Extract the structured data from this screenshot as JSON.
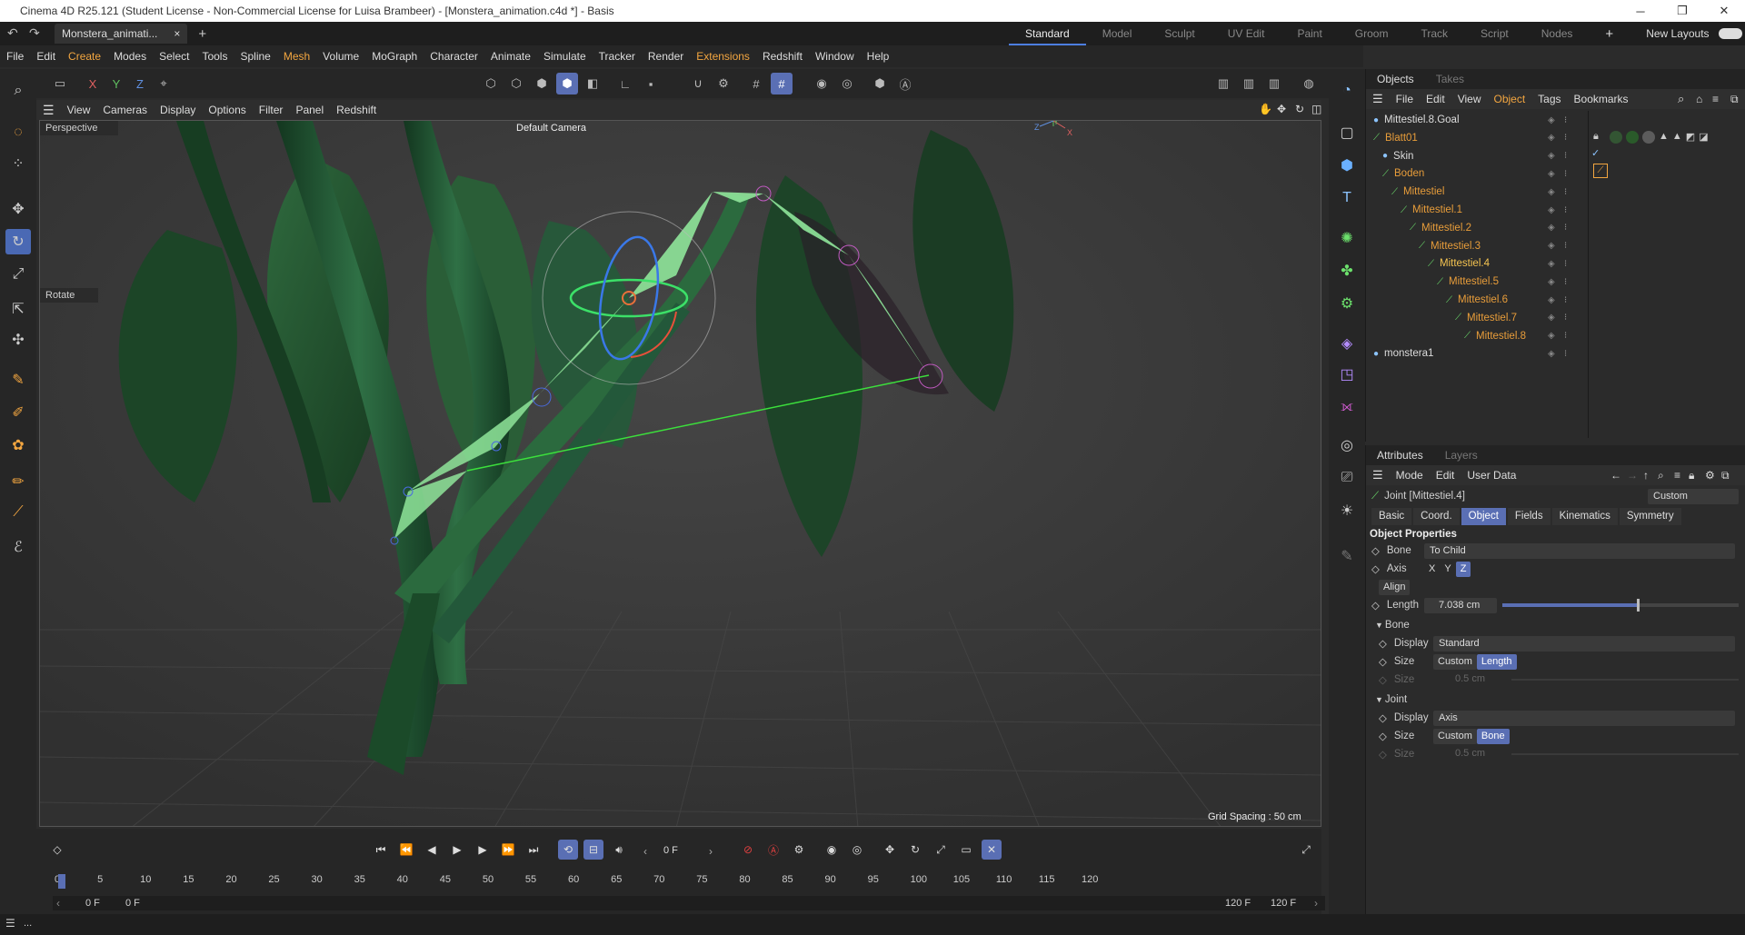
{
  "window": {
    "title": "Cinema 4D R25.121 (Student License - Non-Commercial License for Luisa Brambeer) - [Monstera_animation.c4d *] - Basis",
    "controls": [
      "─",
      "❐",
      "✕"
    ]
  },
  "doc_tab": {
    "label": "Monstera_animati...",
    "close": "×",
    "add": "+"
  },
  "layouts": {
    "items": [
      "Standard",
      "Model",
      "Sculpt",
      "UV Edit",
      "Paint",
      "Groom",
      "Track",
      "Script",
      "Nodes"
    ],
    "active": "Standard",
    "add": "+",
    "new_layouts": "New Layouts"
  },
  "menu": [
    "File",
    "Edit",
    "Create",
    "Modes",
    "Select",
    "Tools",
    "Spline",
    "Mesh",
    "Volume",
    "MoGraph",
    "Character",
    "Animate",
    "Simulate",
    "Tracker",
    "Render",
    "Extensions",
    "Redshift",
    "Window",
    "Help"
  ],
  "axis_lock": {
    "x": "X",
    "y": "Y",
    "z": "Z"
  },
  "viewport_menu": [
    "View",
    "Cameras",
    "Display",
    "Options",
    "Filter",
    "Panel",
    "Redshift"
  ],
  "viewport": {
    "name": "Perspective",
    "camera": "Default Camera",
    "tool": "Rotate",
    "grid_spacing": "Grid Spacing : 50 cm",
    "axis_x": "X",
    "axis_y": "Y",
    "axis_z": "Z"
  },
  "timeline": {
    "frame": "0 F",
    "ticks": [
      "0",
      "5",
      "10",
      "15",
      "20",
      "25",
      "30",
      "35",
      "40",
      "45",
      "50",
      "55",
      "60",
      "65",
      "70",
      "75",
      "80",
      "85",
      "90",
      "95",
      "100",
      "105",
      "110",
      "115",
      "120"
    ],
    "start": "0 F",
    "start2": "0 F",
    "end": "120 F",
    "end2": "120 F"
  },
  "status": {
    "text": "..."
  },
  "objects": {
    "tabs": [
      "Objects",
      "Takes"
    ],
    "menu": [
      "File",
      "Edit",
      "View",
      "Object",
      "Tags",
      "Bookmarks"
    ],
    "rows": [
      {
        "name": "Mittestiel.8.Goal",
        "indent": 0,
        "cls": "w"
      },
      {
        "name": "Blatt01",
        "indent": 0,
        "cls": ""
      },
      {
        "name": "Skin",
        "indent": 1,
        "cls": "w"
      },
      {
        "name": "Boden",
        "indent": 1,
        "cls": ""
      },
      {
        "name": "Mittestiel",
        "indent": 2,
        "cls": ""
      },
      {
        "name": "Mittestiel.1",
        "indent": 3,
        "cls": ""
      },
      {
        "name": "Mittestiel.2",
        "indent": 4,
        "cls": ""
      },
      {
        "name": "Mittestiel.3",
        "indent": 5,
        "cls": ""
      },
      {
        "name": "Mittestiel.4",
        "indent": 6,
        "cls": "sel"
      },
      {
        "name": "Mittestiel.5",
        "indent": 7,
        "cls": ""
      },
      {
        "name": "Mittestiel.6",
        "indent": 8,
        "cls": ""
      },
      {
        "name": "Mittestiel.7",
        "indent": 9,
        "cls": ""
      },
      {
        "name": "Mittestiel.8",
        "indent": 10,
        "cls": ""
      },
      {
        "name": "monstera1",
        "indent": 0,
        "cls": "w"
      }
    ]
  },
  "attributes": {
    "tabs": [
      "Attributes",
      "Layers"
    ],
    "menu": [
      "Mode",
      "Edit",
      "User Data"
    ],
    "object": "Joint [Mittestiel.4]",
    "preset": "Custom",
    "subtabs": [
      "Basic",
      "Coord.",
      "Object",
      "Fields",
      "Kinematics",
      "Symmetry"
    ],
    "section": "Object Properties",
    "bone_label": "Bone",
    "bone_value": "To Child",
    "axis_label": "Axis",
    "axis_x": "X",
    "axis_y": "Y",
    "axis_z": "Z",
    "align": "Align",
    "length_label": "Length",
    "length_value": "7.038 cm",
    "bone_group": "Bone",
    "display_label": "Display",
    "bone_display": "Standard",
    "size_label": "Size",
    "size_custom": "Custom",
    "size_length": "Length",
    "size_value": "0.5 cm",
    "joint_group": "Joint",
    "joint_display": "Axis",
    "joint_bone": "Bone",
    "joint_size_value": "0.5 cm"
  }
}
